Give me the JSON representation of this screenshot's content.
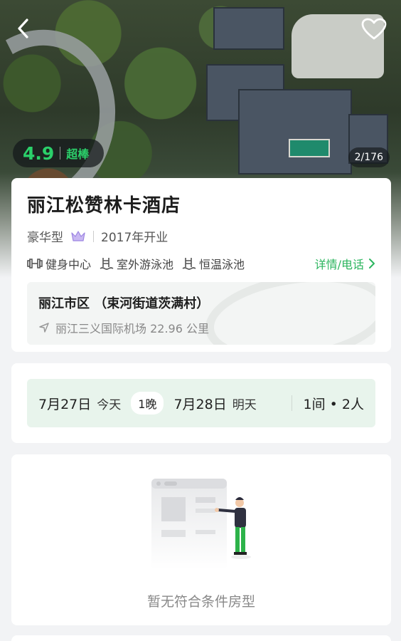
{
  "header": {
    "back_icon": "chevron-left-icon",
    "favorite_icon": "heart-outline-icon"
  },
  "gallery": {
    "rating_score": "4.9",
    "rating_label": "超棒",
    "photo_counter": "2/176"
  },
  "hotel": {
    "name": "丽江松赞林卡酒店",
    "category": "豪华型",
    "category_icon": "crown-icon",
    "opened": "2017年开业",
    "facilities": [
      {
        "icon": "dumbbell-icon",
        "label": "健身中心"
      },
      {
        "icon": "pool-ladder-icon",
        "label": "室外游泳池"
      },
      {
        "icon": "pool-ladder-icon",
        "label": "恒温泳池"
      }
    ],
    "detail_link": "详情/电话",
    "address": "丽江市区 （束河街道茨满村）",
    "distance": "丽江三义国际机场 22.96 公里"
  },
  "booking": {
    "checkin_date": "7月27日",
    "checkin_day": "今天",
    "nights": "1晚",
    "checkout_date": "7月28日",
    "checkout_day": "明天",
    "rooms_guests": "1间 • 2人"
  },
  "rooms": {
    "empty_text": "暂无符合条件房型"
  },
  "colors": {
    "accent": "#2bb55e",
    "rating": "#2bd06a",
    "date_bg": "#e8f4ec"
  }
}
